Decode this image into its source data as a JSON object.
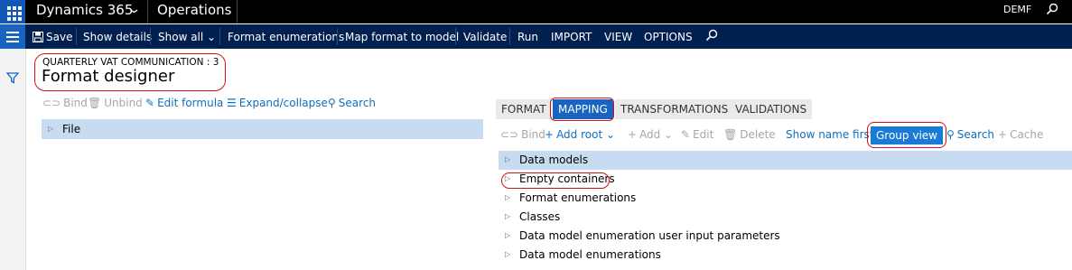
{
  "topbar": {
    "app_name": "Dynamics 365",
    "module": "Operations",
    "company": "DEMF"
  },
  "actions": {
    "save": "Save",
    "show_details": "Show details",
    "show_all": "Show all",
    "format_enumerations": "Format enumerations",
    "map_format_to_model": "Map format to model",
    "validate": "Validate",
    "run": "Run",
    "import": "IMPORT",
    "view": "VIEW",
    "options": "OPTIONS"
  },
  "page": {
    "caption": "QUARTERLY VAT COMMUNICATION : 3",
    "title": "Format designer"
  },
  "left_toolbar": {
    "bind": "Bind",
    "unbind": "Unbind",
    "edit_formula": "Edit formula",
    "expand_collapse": "Expand/collapse",
    "search": "Search"
  },
  "left_tree": {
    "items": [
      "File"
    ]
  },
  "tabs": [
    "FORMAT",
    "MAPPING",
    "TRANSFORMATIONS",
    "VALIDATIONS"
  ],
  "active_tab": "MAPPING",
  "mapping_toolbar": {
    "bind": "Bind",
    "add_root": "Add root",
    "add": "Add",
    "edit": "Edit",
    "delete": "Delete",
    "show_name_first": "Show name first",
    "group_view": "Group view",
    "search": "Search",
    "cache": "Cache"
  },
  "mapping_tree": {
    "items": [
      "Data models",
      "Empty containers",
      "Format enumerations",
      "Classes",
      "Data model enumeration user input parameters",
      "Data model enumerations"
    ]
  },
  "colors": {
    "nav_black": "#000000",
    "action_bar": "#002050",
    "accent": "#1765c1",
    "selected_row": "#c7dcf0",
    "highlight_circle": "#d0101b"
  }
}
